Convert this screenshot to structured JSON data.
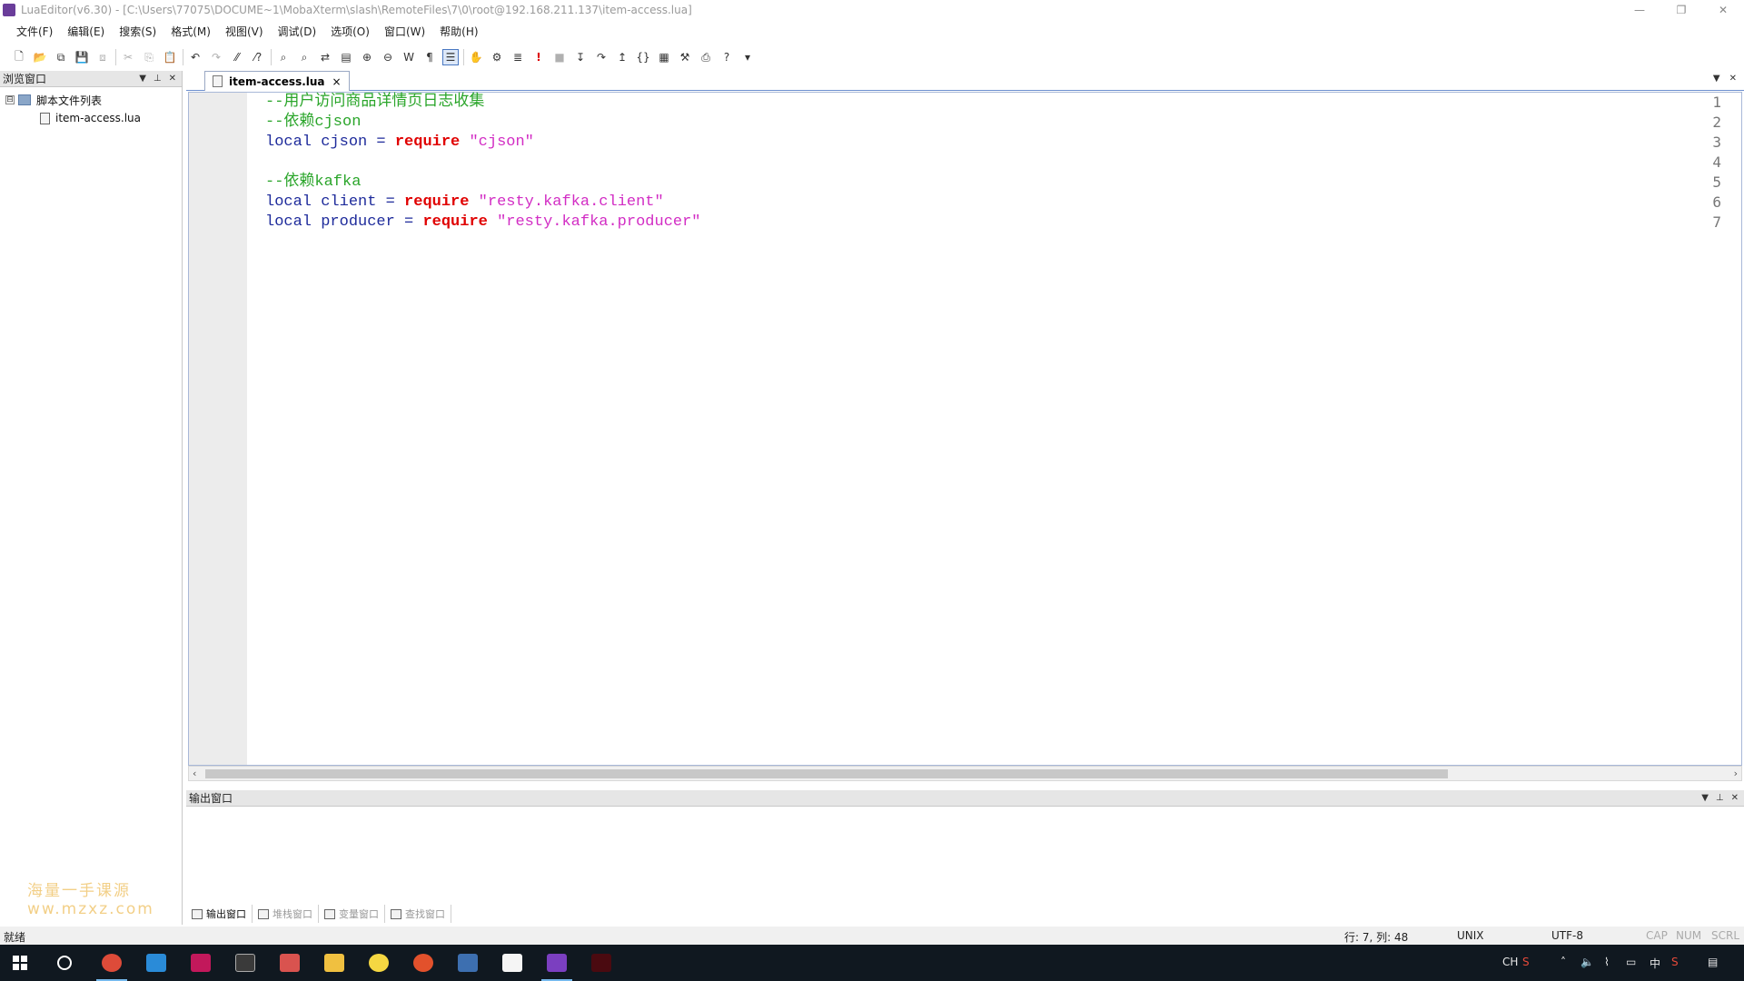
{
  "window": {
    "title": "LuaEditor(v6.30) - [C:\\Users\\77075\\DOCUME~1\\MobaXterm\\slash\\RemoteFiles\\7\\0\\root@192.168.211.137\\item-access.lua]",
    "controls": [
      "minimize-icon",
      "restore-icon",
      "close-icon"
    ]
  },
  "menu": [
    "文件(F)",
    "编辑(E)",
    "搜索(S)",
    "格式(M)",
    "视图(V)",
    "调试(D)",
    "选项(O)",
    "窗口(W)",
    "帮助(H)"
  ],
  "browser_panel": {
    "title": "浏览窗口",
    "tree_root": "脚本文件列表",
    "tree_toggle": "⊟",
    "files": [
      "item-access.lua"
    ],
    "watermark": "海量一手课源 ww.mzxz.com"
  },
  "editor": {
    "tab_label": "item-access.lua",
    "tab_close": "×",
    "line_numbers": [
      "1",
      "2",
      "3",
      "4",
      "5",
      "6",
      "7"
    ],
    "lines": [
      [
        {
          "t": "--用户访问商品详情页日志收集",
          "c": "cmt"
        }
      ],
      [
        {
          "t": "--依赖cjson",
          "c": "cmt"
        }
      ],
      [
        {
          "t": "local",
          "c": "kw"
        },
        {
          "t": " cjson = ",
          "c": "id"
        },
        {
          "t": "require",
          "c": "rq"
        },
        {
          "t": " ",
          "c": "id"
        },
        {
          "t": "\"cjson\"",
          "c": "str"
        }
      ],
      [],
      [
        {
          "t": "--依赖kafka",
          "c": "cmt"
        }
      ],
      [
        {
          "t": "local",
          "c": "kw"
        },
        {
          "t": " client = ",
          "c": "id"
        },
        {
          "t": "require",
          "c": "rq"
        },
        {
          "t": " ",
          "c": "id"
        },
        {
          "t": "\"resty.kafka.client\"",
          "c": "str"
        }
      ],
      [
        {
          "t": "local",
          "c": "kw"
        },
        {
          "t": " producer = ",
          "c": "id"
        },
        {
          "t": "require",
          "c": "rq"
        },
        {
          "t": " ",
          "c": "id"
        },
        {
          "t": "\"resty.kafka.producer\"",
          "c": "str"
        }
      ]
    ]
  },
  "output_panel": {
    "title": "输出窗口",
    "tabs": [
      "输出窗口",
      "堆栈窗口",
      "变量窗口",
      "查找窗口"
    ]
  },
  "status": {
    "ready": "就绪",
    "position": "行: 7, 列: 48",
    "line_ending": "UNIX",
    "encoding": "UTF-8",
    "cap": "CAP",
    "num": "NUM",
    "scrl": "SCRL"
  },
  "taskbar": {
    "tray_lang": "CH",
    "tray_ime": "中"
  },
  "colors": {
    "keyword": "#1e2b9b",
    "require": "#e00000",
    "string": "#d22dc4",
    "comment": "#2aa52a",
    "gutter": "#ececec"
  }
}
